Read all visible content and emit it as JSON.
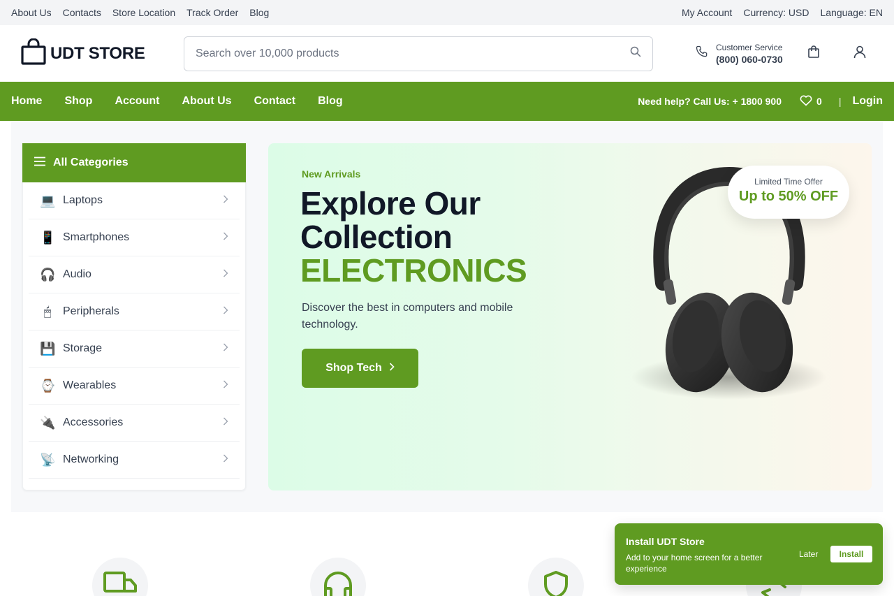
{
  "topbar": {
    "links": [
      "About Us",
      "Contacts",
      "Store Location",
      "Track Order",
      "Blog"
    ],
    "my_account": "My Account",
    "currency": "Currency: USD",
    "language": "Language: EN"
  },
  "header": {
    "logo_text": "UDT STORE",
    "search_placeholder": "Search over 10,000 products",
    "service_label": "Customer Service",
    "service_phone": "(800) 060-0730"
  },
  "nav": {
    "items": [
      "Home",
      "Shop",
      "Account",
      "About Us",
      "Contact",
      "Blog"
    ],
    "help_prefix": "Need help? Call Us:",
    "help_phone": "+ 1800 900",
    "wishlist_count": "0",
    "separator": "|",
    "login": "Login"
  },
  "categories": {
    "title": "All Categories",
    "items": [
      {
        "icon": "laptop-icon",
        "glyph": "💻",
        "label": "Laptops"
      },
      {
        "icon": "smartphone-icon",
        "glyph": "📱",
        "label": "Smartphones"
      },
      {
        "icon": "headphones-icon",
        "glyph": "🎧",
        "label": "Audio"
      },
      {
        "icon": "mouse-icon",
        "glyph": "🖱",
        "label": "Peripherals"
      },
      {
        "icon": "floppy-disk-icon",
        "glyph": "💾",
        "label": "Storage"
      },
      {
        "icon": "watch-icon",
        "glyph": "⌚",
        "label": "Wearables"
      },
      {
        "icon": "plug-icon",
        "glyph": "🔌",
        "label": "Accessories"
      },
      {
        "icon": "satellite-antenna-icon",
        "glyph": "📡",
        "label": "Networking"
      }
    ]
  },
  "hero": {
    "kicker": "New Arrivals",
    "title_line1": "Explore Our",
    "title_line2": "Collection",
    "title_accent": "ELECTRONICS",
    "description": "Discover the best in computers and mobile technology.",
    "button": "Shop Tech",
    "offer_small": "Limited Time Offer",
    "offer_big": "Up to 50% OFF"
  },
  "install": {
    "title": "Install UDT Store",
    "text": "Add to your home screen for a better experience",
    "later": "Later",
    "install": "Install"
  },
  "colors": {
    "brand_green": "#5f9b21",
    "topbar_bg": "#f3f4f6",
    "text_dark": "#111827"
  }
}
